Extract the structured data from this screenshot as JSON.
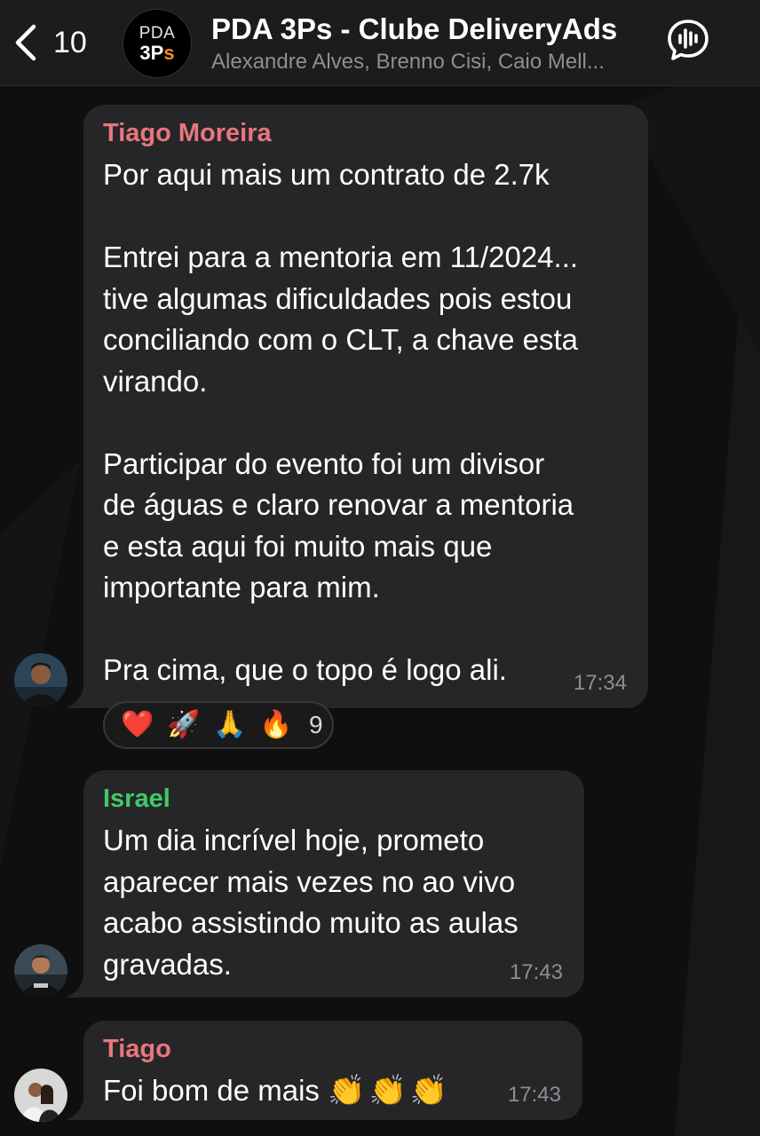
{
  "header": {
    "back_count": "10",
    "avatar_line1": "PDA",
    "avatar_line2_main": "3P",
    "avatar_line2_accent": "s",
    "title": "PDA 3Ps - Clube DeliveryAds",
    "subtitle": "Alexandre Alves, Brenno Cisi, Caio Mell..."
  },
  "messages": [
    {
      "sender": "Tiago Moreira",
      "sender_color": "#e8767e",
      "text": "Por aqui mais um contrato de 2.7k\n\nEntrei para a mentoria em 11/2024...\ntive algumas dificuldades pois estou\nconciliando com o CLT, a chave esta\nvirando.\n\nParticipar do evento foi um divisor\nde águas e claro renovar a mentoria\ne esta aqui foi muito mais que\nimportante para mim.\n\nPra cima, que o topo é logo ali.",
      "time": "17:34",
      "reactions": [
        "❤️",
        "🚀",
        "🙏",
        "🔥"
      ],
      "reaction_count": "9"
    },
    {
      "sender": "Israel",
      "sender_color": "#3fca6b",
      "text": "Um dia incrível hoje, prometo\naparecer mais vezes no ao vivo\nacabo assistindo muito as aulas\ngravadas.",
      "time": "17:43"
    },
    {
      "sender": "Tiago",
      "sender_color": "#e8767e",
      "text": "Foi bom de mais",
      "emoji": "👏👏👏",
      "time": "17:43"
    }
  ],
  "icons": {
    "back": "chevron-left-icon",
    "voice_chat": "voice-chat-icon"
  }
}
